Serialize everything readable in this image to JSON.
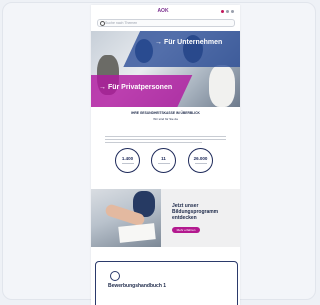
{
  "header": {
    "logo_text": "AOK",
    "search_placeholder": "Suche nach Themen"
  },
  "hero": {
    "label_unternehmen": "→ Für Unternehmen",
    "label_privatpersonen": "→ Für Privatpersonen"
  },
  "intro": {
    "title": "IHRE GESUNDHEITSKASSE IM ÜBERBLICK",
    "subtitle": "Wir sind für Sie da"
  },
  "stats": [
    {
      "value": "1.400"
    },
    {
      "value": "11"
    },
    {
      "value": "26.000"
    }
  ],
  "promo": {
    "title": "Jetzt unser Bildungsprogramm entdecken",
    "button_label": "Mehr erfahren"
  },
  "card2": {
    "title": "Bewerbungshandbuch 1"
  },
  "colors": {
    "brand_purple": "#7a2e8e",
    "magenta": "#b1199f",
    "navy": "#1e2a5a",
    "blue": "#284a96"
  }
}
